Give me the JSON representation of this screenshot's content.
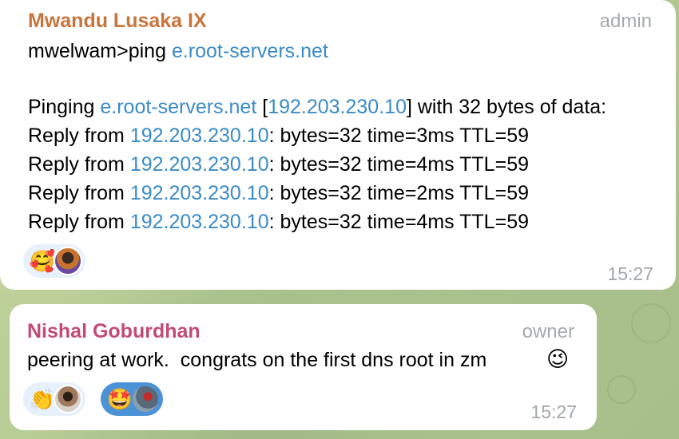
{
  "messages": [
    {
      "sender": "Mwandu Lusaka IX",
      "sender_color": "#c9743a",
      "role": "admin",
      "command_prompt": "mwelwam>ping ",
      "command_host": "e.root-servers.net",
      "pinging": {
        "prefix": "Pinging ",
        "host": "e.root-servers.net",
        "bracket_open": " [",
        "ip": "192.203.230.10",
        "suffix": "] with 32 bytes of data:"
      },
      "replies": [
        {
          "prefix": "Reply from ",
          "ip": "192.203.230.10",
          "rest": ": bytes=32 time=3ms TTL=59"
        },
        {
          "prefix": "Reply from ",
          "ip": "192.203.230.10",
          "rest": ": bytes=32 time=4ms TTL=59"
        },
        {
          "prefix": "Reply from ",
          "ip": "192.203.230.10",
          "rest": ": bytes=32 time=2ms TTL=59"
        },
        {
          "prefix": "Reply from ",
          "ip": "192.203.230.10",
          "rest": ": bytes=32 time=4ms TTL=59"
        }
      ],
      "reactions": [
        {
          "emoji": "🥰",
          "icon": "smiling-face-with-hearts-icon"
        }
      ],
      "time": "15:27"
    },
    {
      "sender": "Nishal Goburdhan",
      "sender_color": "#c24b73",
      "role": "owner",
      "text": "peering at work.  congrats on the first dns root in zm",
      "text_emoji": "😉",
      "reactions": [
        {
          "emoji": "👏",
          "icon": "clapping-hands-icon"
        },
        {
          "emoji": "🤩",
          "icon": "star-struck-icon",
          "selected": true
        }
      ],
      "time": "15:27"
    }
  ],
  "colors": {
    "link": "#3a8bc7",
    "bubble": "#ffffff",
    "meta_text": "#a5a9ad",
    "reaction_bg": "#e7f1fb",
    "reaction_selected_bg": "#4c92d6"
  }
}
